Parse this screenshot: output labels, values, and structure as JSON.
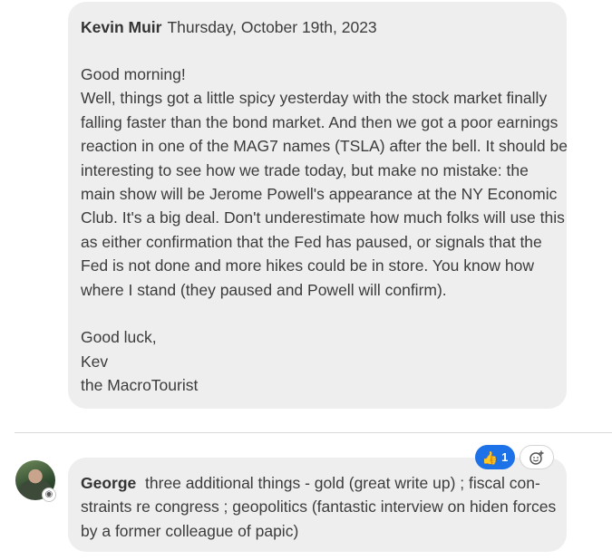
{
  "main_message": {
    "author": "Kevin Muir",
    "date": "Thursday, October 19th, 2023",
    "lines": [
      "Good morning!",
      "Well, things got a little spicy yesterday with the stock market finally",
      "falling faster than the bond market. And then we got a poor earnings",
      "reaction in one of the MAG7 names (TSLA) after the bell. It should be",
      "interesting to see how we trade today, but make no mistake: the",
      "main show will be Jerome Powell's appearance at the NY Economic",
      "Club. It's a big deal. Don't underestimate how much folks will use this",
      "as either confirmation that the Fed has paused, or signals that the",
      "Fed is not done and more hikes could be in store. You know how",
      "where I stand (they paused and Powell will confirm).",
      "Good luck,",
      "Kev",
      "the MacroTourist"
    ]
  },
  "reply": {
    "author": "George",
    "lines": [
      "three additional things - gold (great write up) ; fiscal con-",
      "straints re congress ; geopolitics (fantastic interview on hiden forces",
      "by a former colleague of papic)"
    ],
    "reaction": {
      "icon": "thumbs-up-icon",
      "count": "1",
      "color": "#1e72e8"
    }
  },
  "colors": {
    "bubble": "#eeeeee",
    "text": "#3c3c3c",
    "divider": "#d8d8d8"
  }
}
